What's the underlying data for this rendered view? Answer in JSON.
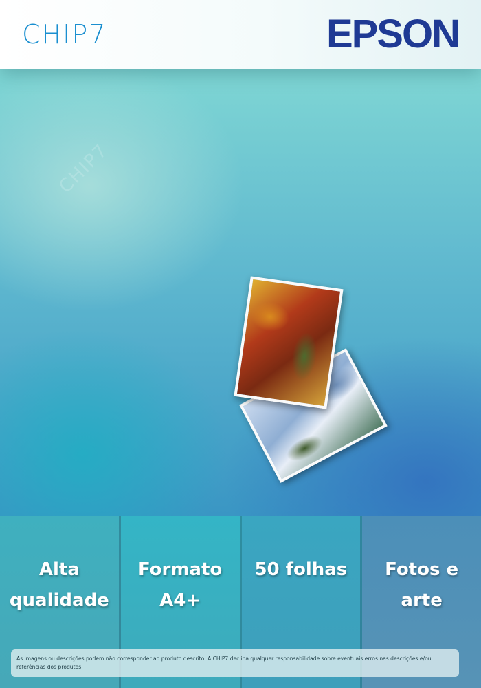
{
  "header": {
    "left_logo": "CHIP7",
    "right_logo": "EPSON",
    "colors": {
      "chip7": "#1a8fd0",
      "epson": "#1f3a94"
    }
  },
  "hero": {
    "watermark": "CHIP7",
    "image": "stacked-photo-prints"
  },
  "features": [
    {
      "line1": "Alta",
      "line2": "qualidade"
    },
    {
      "line1": "Formato",
      "line2": "A4+"
    },
    {
      "line1": "50 folhas",
      "line2": ""
    },
    {
      "line1": "Fotos e",
      "line2": "arte"
    }
  ],
  "disclaimer": "As imagens ou descrições podem não corresponder ao produto descrito. A CHIP7 declina qualquer responsabilidade sobre eventuais erros nas descrições e/ou referências dos produtos."
}
